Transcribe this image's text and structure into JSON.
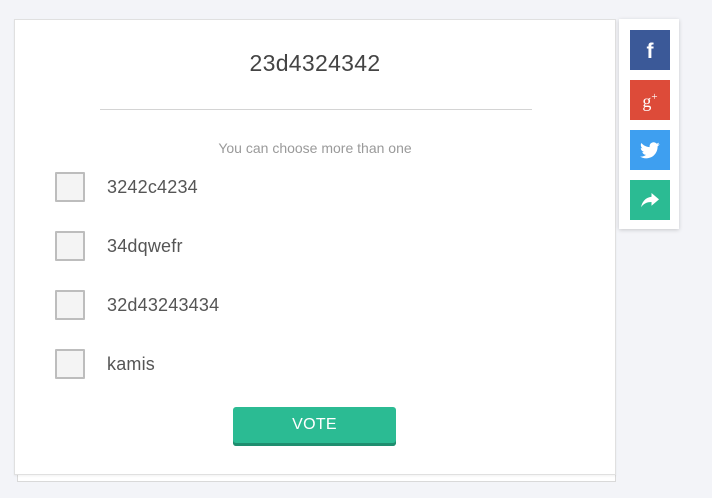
{
  "poll": {
    "title": "23d4324342",
    "hint": "You can choose more than one",
    "options": [
      {
        "label": "3242c4234",
        "checked": false
      },
      {
        "label": "34dqwefr",
        "checked": false
      },
      {
        "label": "32d43243434",
        "checked": false
      },
      {
        "label": "kamis",
        "checked": false
      }
    ],
    "vote_label": "VOTE"
  },
  "share": {
    "buttons": [
      {
        "icon": "facebook-icon",
        "color": "#3b5998"
      },
      {
        "icon": "google-plus-icon",
        "color": "#dd4b39"
      },
      {
        "icon": "twitter-icon",
        "color": "#3e9ff0"
      },
      {
        "icon": "share-icon",
        "color": "#2bbb93"
      }
    ]
  },
  "colors": {
    "accent": "#2bbb93",
    "background": "#f3f4f8"
  }
}
